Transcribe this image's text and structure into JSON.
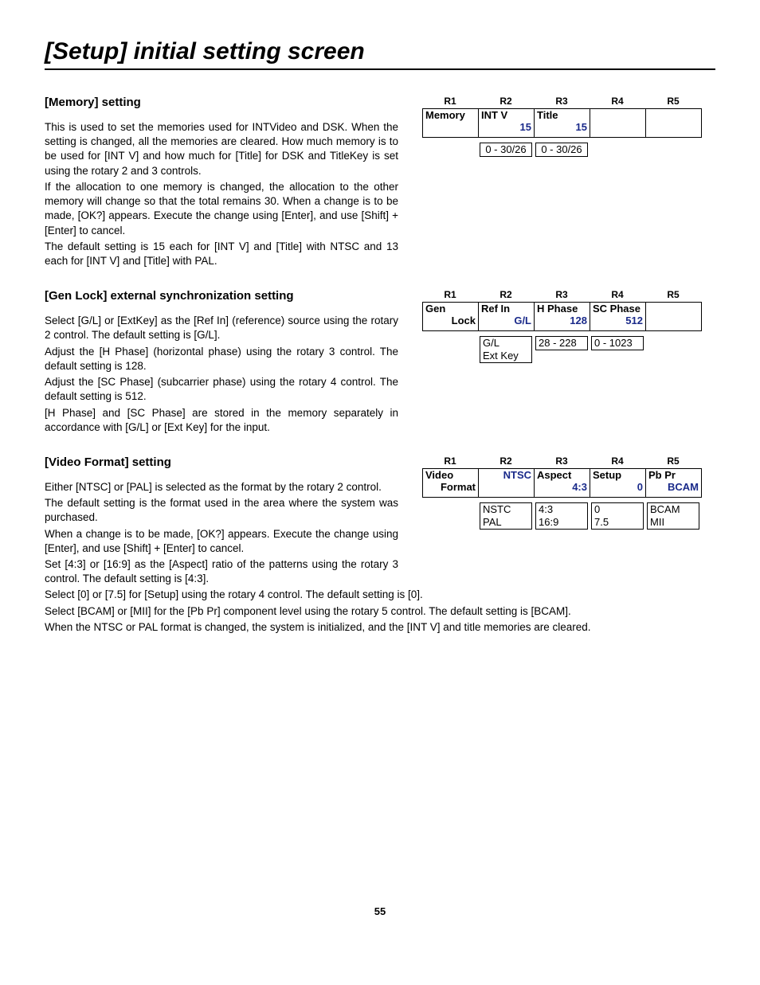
{
  "pageTitle": "[Setup] initial setting screen",
  "pageNumber": "55",
  "rHeads": [
    "R1",
    "R2",
    "R3",
    "R4",
    "R5"
  ],
  "memory": {
    "heading": "[Memory] setting",
    "p1": "This is used to set the memories used for INTVideo and DSK.  When the setting is changed, all the memories are cleared.  How much memory is to be used for [INT V] and how much for [Title] for DSK and TitleKey is set using the rotary 2 and 3 controls.",
    "p2": "If the allocation to one memory is changed, the allocation to the other memory will change so that the total remains 30. When a change is to be made, [OK?] appears.  Execute the change using [Enter], and use [Shift] + [Enter] to cancel.",
    "p3": "The default setting is 15 each for [INT V] and [Title] with NTSC and 13 each for [INT V] and [Title] with PAL.",
    "t": {
      "c1Top": "Memory",
      "c1Bot": "",
      "c2Top": "INT V",
      "c2Bot": "15",
      "c3Top": "Title",
      "c3Bot": "15",
      "r2": "0 - 30/26",
      "r3": "0 - 30/26"
    }
  },
  "genlock": {
    "heading": "[Gen Lock] external synchronization setting",
    "p1": "Select [G/L] or [ExtKey] as the [Ref In] (reference) source using the rotary 2 control.  The default setting is [G/L].",
    "p2": "Adjust the [H Phase] (horizontal phase) using the rotary 3 control.  The default setting is 128.",
    "p3": "Adjust the [SC Phase] (subcarrier phase) using the rotary 4 control.  The default setting is 512.",
    "p4": "[H Phase] and [SC  Phase] are stored in the memory separately in accordance with [G/L] or [Ext Key] for the input.",
    "t": {
      "c1Top": "Gen",
      "c1Bot": "Lock",
      "c2Top": "Ref In",
      "c2Bot": "G/L",
      "c3Top": "H Phase",
      "c3Bot": "128",
      "c4Top": "SC Phase",
      "c4Bot": "512",
      "o2a": "G/L",
      "o2b": "Ext Key",
      "o3": "28 - 228",
      "o4": "0 - 1023"
    }
  },
  "video": {
    "heading": "[Video Format] setting",
    "p1": "Either [NTSC] or [PAL] is selected as the format by the rotary 2 control.",
    "p2": "The default setting is the format used in the area where the system was purchased.",
    "p3": "When a change is to be made, [OK?] appears.  Execute the change using [Enter], and use [Shift] + [Enter] to cancel.",
    "p4": "Set [4:3] or [16:9] as the [Aspect] ratio of the patterns using the rotary 3 control.  The default setting is [4:3].",
    "p5": "Select [0] or [7.5] for [Setup] using the rotary 4 control.  The default setting is [0].",
    "p6": "Select [BCAM] or [MII] for the [Pb Pr] component level using the rotary 5 control.  The default setting is [BCAM].",
    "p7": "When the NTSC or PAL format is changed, the system is initialized, and the [INT V] and title memories are cleared.",
    "t": {
      "c1Top": "Video",
      "c1Bot": "Format",
      "c2Top": "",
      "c2Bot": "NTSC",
      "c3Top": "Aspect",
      "c3Bot": "4:3",
      "c4Top": "Setup",
      "c4Bot": "0",
      "c5Top": "Pb Pr",
      "c5Bot": "BCAM",
      "o2a": "NSTC",
      "o2b": "PAL",
      "o3a": "4:3",
      "o3b": "16:9",
      "o4a": "0",
      "o4b": "7.5",
      "o5a": "BCAM",
      "o5b": "MII"
    }
  }
}
